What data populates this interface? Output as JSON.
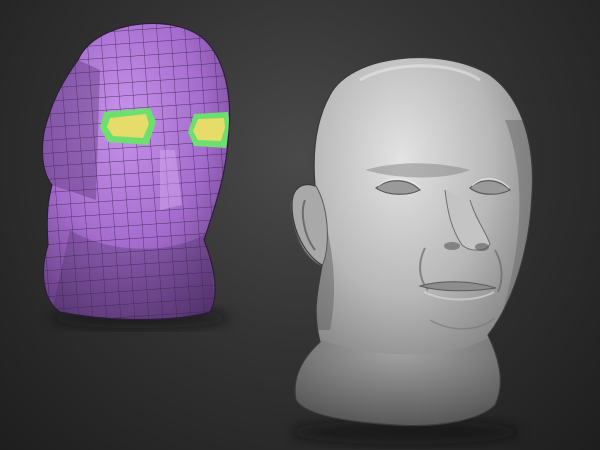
{
  "scene": {
    "background_color": "#333333",
    "objects": [
      {
        "name": "low-poly-head",
        "kind": "polygon-mesh-base",
        "color": "#a86fd1",
        "polygroup_color": "#e6dc69",
        "polygroup_border_color": "#6ddf6f"
      },
      {
        "name": "sculpted-head",
        "kind": "high-res-sculpt",
        "color": "#bdbdbd"
      }
    ]
  }
}
